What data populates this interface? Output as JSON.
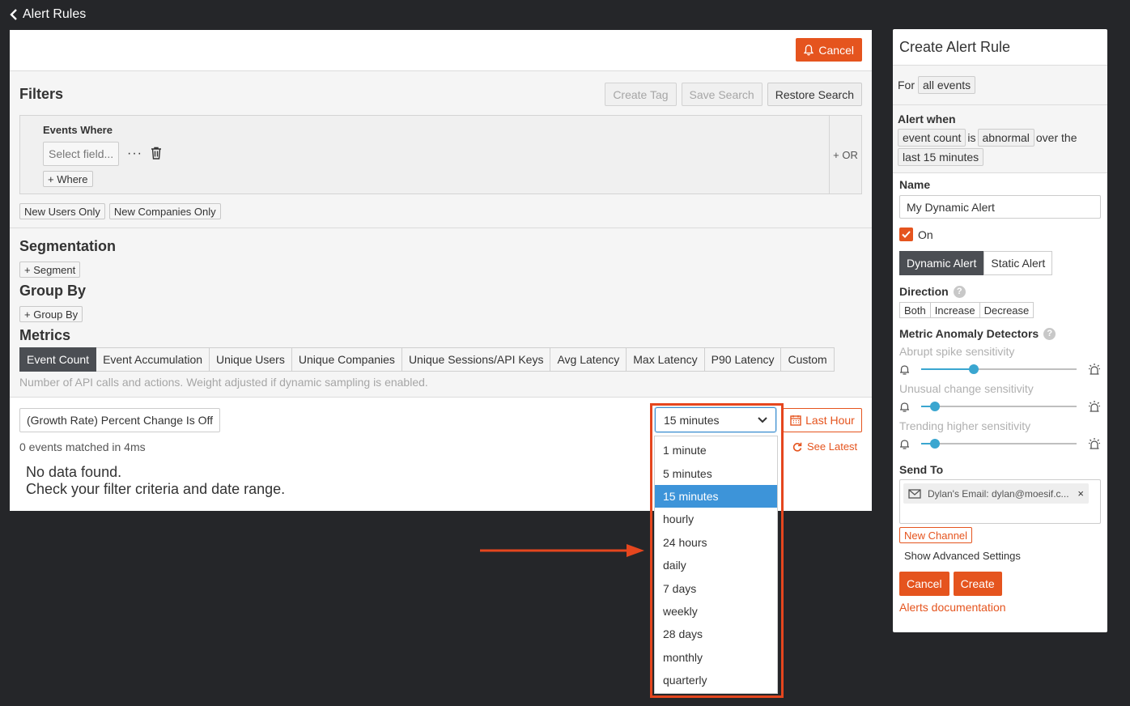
{
  "nav": {
    "back_label": "Alert Rules"
  },
  "header": {
    "cancel_label": "Cancel"
  },
  "filters": {
    "title": "Filters",
    "create_tag": "Create Tag",
    "save_search": "Save Search",
    "restore_search": "Restore Search",
    "events_where": "Events Where",
    "select_field_placeholder": "Select field...",
    "more": "···",
    "add_where": "+ Where",
    "or": "+ OR",
    "new_users_only": "New Users Only",
    "new_companies_only": "New Companies Only"
  },
  "segmentation": {
    "title": "Segmentation",
    "add": "+ Segment"
  },
  "group_by": {
    "title": "Group By",
    "add": "+ Group By"
  },
  "metrics": {
    "title": "Metrics",
    "tabs": [
      "Event Count",
      "Event Accumulation",
      "Unique Users",
      "Unique Companies",
      "Unique Sessions/API Keys",
      "Avg Latency",
      "Max Latency",
      "P90 Latency",
      "Custom"
    ],
    "active_tab": "Event Count",
    "hint": "Number of API calls and actions. Weight adjusted if dynamic sampling is enabled."
  },
  "results": {
    "growth_label": "(Growth Rate) Percent Change Is Off",
    "matched": "0 events matched in 4ms",
    "no_data_1": "No data found.",
    "no_data_2": "Check your filter criteria and date range.",
    "interval_value": "15 minutes",
    "last_hour": "Last Hour",
    "see_latest": "See Latest"
  },
  "interval_options": [
    "1 minute",
    "5 minutes",
    "15 minutes",
    "hourly",
    "24 hours",
    "daily",
    "7 days",
    "weekly",
    "28 days",
    "monthly",
    "quarterly"
  ],
  "interval_selected": "15 minutes",
  "side": {
    "title": "Create Alert Rule",
    "for_label": "For",
    "for_value": "all events",
    "alert_when": "Alert when",
    "metric": "event count",
    "is": "is",
    "condition": "abnormal",
    "over_the": "over the",
    "period": "last 15 minutes",
    "name_label": "Name",
    "name_value": "My Dynamic Alert",
    "on_label": "On",
    "dynamic_alert": "Dynamic Alert",
    "static_alert": "Static Alert",
    "direction_label": "Direction",
    "direction_options": [
      "Both",
      "Increase",
      "Decrease"
    ],
    "detectors_label": "Metric Anomaly Detectors",
    "sensitivities": [
      {
        "label": "Abrupt spike sensitivity",
        "value": 0.34
      },
      {
        "label": "Unusual change sensitivity",
        "value": 0.09
      },
      {
        "label": "Trending higher sensitivity",
        "value": 0.09
      }
    ],
    "send_to_label": "Send To",
    "channel": "Dylan's Email: dylan@moesif.c...",
    "remove": "×",
    "new_channel": "New Channel",
    "advanced": "Show Advanced Settings",
    "cancel": "Cancel",
    "create": "Create",
    "docs": "Alerts documentation"
  },
  "colors": {
    "accent": "#e5541e",
    "selected": "#3d94d9",
    "dark_tab": "#4b4e53",
    "slider": "#3aa6d0"
  }
}
